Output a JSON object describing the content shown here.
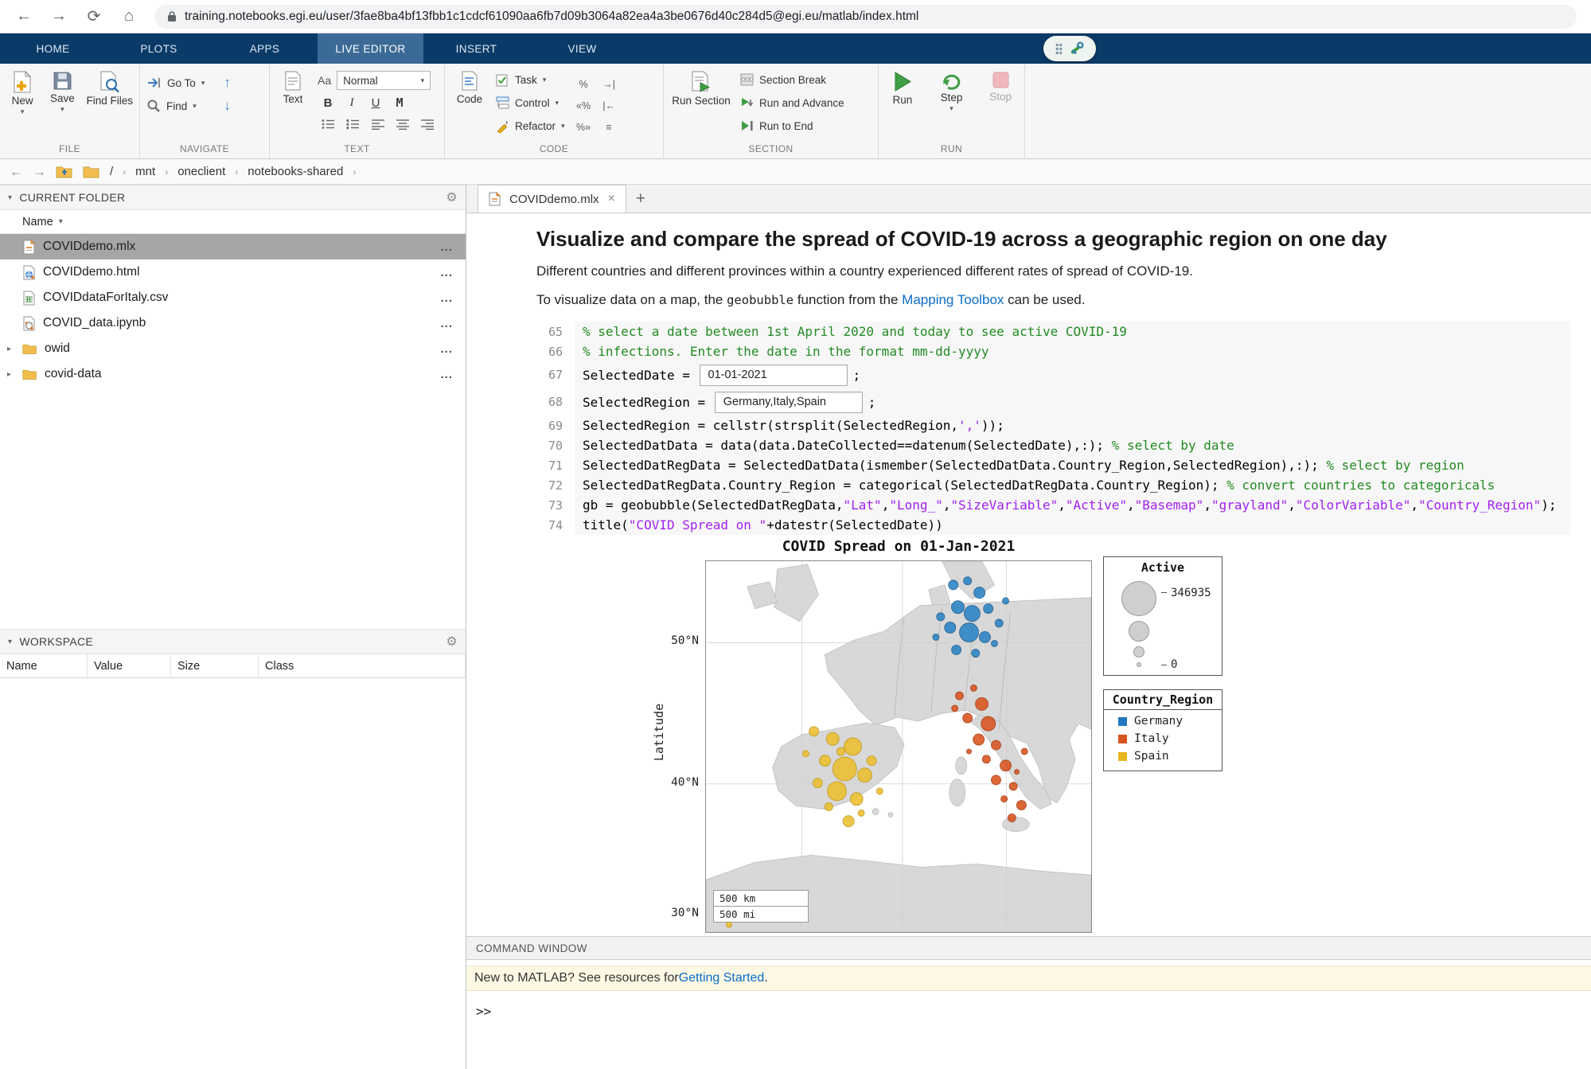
{
  "browser": {
    "url": "training.notebooks.egi.eu/user/3fae8ba4bf13fbb1c1cdcf61090aa6fb7d09b3064a82ea4a3be0676d40c284d5@egi.eu/matlab/index.html"
  },
  "ribbon": {
    "tabs": [
      {
        "label": "HOME"
      },
      {
        "label": "PLOTS"
      },
      {
        "label": "APPS"
      },
      {
        "label": "LIVE EDITOR",
        "active": true
      },
      {
        "label": "INSERT"
      },
      {
        "label": "VIEW"
      }
    ]
  },
  "toolstrip": {
    "file": {
      "label": "FILE",
      "new": "New",
      "save": "Save",
      "find_files": "Find Files"
    },
    "navigate": {
      "label": "NAVIGATE",
      "goto": "Go To",
      "find": "Find"
    },
    "text": {
      "label": "TEXT",
      "text": "Text",
      "style_icon": "Aa",
      "style": "Normal",
      "bold": "B",
      "italic": "I",
      "underline": "U",
      "mono": "M"
    },
    "code": {
      "label": "CODE",
      "code": "Code",
      "task": "Task",
      "control": "Control",
      "refactor": "Refactor",
      "comment": "%",
      "comment_wrap": "%»",
      "uncomment": "«%",
      "indent": "→|",
      "outdent": "|←",
      "smart_indent": "≡"
    },
    "section": {
      "label": "SECTION",
      "run_section": "Run Section",
      "section_break": "Section Break",
      "run_and_advance": "Run and Advance",
      "run_to_end": "Run to End"
    },
    "run": {
      "label": "RUN",
      "run": "Run",
      "step": "Step",
      "stop": "Stop"
    }
  },
  "breadcrumb": {
    "root": "/",
    "segments": [
      "mnt",
      "oneclient",
      "notebooks-shared"
    ]
  },
  "current_folder": {
    "title": "CURRENT FOLDER",
    "name_header": "Name",
    "ellipsis": "...",
    "files": [
      {
        "name": "COVIDdemo.mlx",
        "type": "mlx",
        "selected": true
      },
      {
        "name": "COVIDdemo.html",
        "type": "html"
      },
      {
        "name": "COVIDdataForItaly.csv",
        "type": "csv"
      },
      {
        "name": "COVID_data.ipynb",
        "type": "ipynb"
      },
      {
        "name": "owid",
        "type": "folder"
      },
      {
        "name": "covid-data",
        "type": "folder"
      }
    ]
  },
  "workspace": {
    "title": "WORKSPACE",
    "columns": [
      "Name",
      "Value",
      "Size",
      "Class"
    ]
  },
  "editor": {
    "tab": "COVIDdemo.mlx",
    "close": "×",
    "plus": "+",
    "title": "Visualize and compare the spread of COVID-19 across a geographic region on one day",
    "para1": "Different countries and different provinces within a country experienced different rates of spread of COVID-19.",
    "para2_runs": [
      {
        "k": "text",
        "t": "To visualize data on a map, the "
      },
      {
        "k": "code",
        "t": "geobubble"
      },
      {
        "k": "text",
        "t": " function from the "
      },
      {
        "k": "link",
        "t": "Mapping Toolbox"
      },
      {
        "k": "text",
        "t": " can be used."
      }
    ],
    "code": [
      {
        "num": "65",
        "segments": [
          {
            "k": "comment",
            "t": "% select a date between 1st April 2020 and today to see active COVID-19"
          }
        ]
      },
      {
        "num": "66",
        "segments": [
          {
            "k": "comment",
            "t": "% infections. Enter the date in the format mm-dd-yyyy"
          }
        ]
      },
      {
        "num": "67",
        "segments": [
          {
            "k": "code",
            "t": "SelectedDate = "
          },
          {
            "k": "input",
            "t": "01-01-2021"
          },
          {
            "k": "code",
            "t": ";"
          }
        ]
      },
      {
        "num": "68",
        "segments": [
          {
            "k": "code",
            "t": "SelectedRegion = "
          },
          {
            "k": "input",
            "t": "Germany,Italy,Spain"
          },
          {
            "k": "code",
            "t": ";"
          }
        ]
      },
      {
        "num": "69",
        "segments": [
          {
            "k": "code",
            "t": "SelectedRegion = cellstr(strsplit(SelectedRegion,"
          },
          {
            "k": "string",
            "t": "','"
          },
          {
            "k": "code",
            "t": "));"
          }
        ]
      },
      {
        "num": "70",
        "segments": [
          {
            "k": "code",
            "t": "SelectedDatData = data(data.DateCollected==datenum(SelectedDate),:); "
          },
          {
            "k": "comment",
            "t": "% select by date"
          }
        ]
      },
      {
        "num": "71",
        "segments": [
          {
            "k": "code",
            "t": "SelectedDatRegData = SelectedDatData(ismember(SelectedDatData.Country_Region,SelectedRegion),:); "
          },
          {
            "k": "comment",
            "t": "% select by region"
          }
        ]
      },
      {
        "num": "72",
        "segments": [
          {
            "k": "code",
            "t": "SelectedDatRegData.Country_Region = categorical(SelectedDatRegData.Country_Region); "
          },
          {
            "k": "comment",
            "t": "% convert countries to categoricals"
          }
        ]
      },
      {
        "num": "73",
        "segments": [
          {
            "k": "code",
            "t": "gb = geobubble(SelectedDatRegData,"
          },
          {
            "k": "string",
            "t": "\"Lat\""
          },
          {
            "k": "code",
            "t": ","
          },
          {
            "k": "string",
            "t": "\"Long_\""
          },
          {
            "k": "code",
            "t": ","
          },
          {
            "k": "string",
            "t": "\"SizeVariable\""
          },
          {
            "k": "code",
            "t": ","
          },
          {
            "k": "string",
            "t": "\"Active\""
          },
          {
            "k": "code",
            "t": ","
          },
          {
            "k": "string",
            "t": "\"Basemap\""
          },
          {
            "k": "code",
            "t": ","
          },
          {
            "k": "string",
            "t": "\"grayland\""
          },
          {
            "k": "code",
            "t": ","
          },
          {
            "k": "string",
            "t": "\"ColorVariable\""
          },
          {
            "k": "code",
            "t": ","
          },
          {
            "k": "string",
            "t": "\"Country_Region\""
          },
          {
            "k": "code",
            "t": ");"
          }
        ]
      },
      {
        "num": "74",
        "segments": [
          {
            "k": "code",
            "t": "title("
          },
          {
            "k": "string",
            "t": "\"COVID Spread on \""
          },
          {
            "k": "code",
            "t": "+datestr(SelectedDate))"
          }
        ]
      }
    ]
  },
  "chart_data": {
    "type": "scatter",
    "subtype": "geobubble",
    "title": "COVID Spread on 01-Jan-2021",
    "ylabel": "Latitude",
    "yticks": [
      {
        "label": "50°N",
        "y_pct": 22
      },
      {
        "label": "40°N",
        "y_pct": 60
      },
      {
        "label": "30°N",
        "y_pct": 95
      }
    ],
    "scale": {
      "km": "500 km",
      "mi": "500 mi"
    },
    "size_legend": {
      "title": "Active",
      "max": "346935",
      "min": "0"
    },
    "color_legend": {
      "title": "Country_Region",
      "entries": [
        {
          "label": "Germany",
          "color": "#1f78bf"
        },
        {
          "label": "Italy",
          "color": "#d9541e"
        },
        {
          "label": "Spain",
          "color": "#e8b51f"
        }
      ]
    },
    "series": [
      {
        "name": "Germany",
        "color": "#2b83c4",
        "edge": "#1b5e93",
        "bubbles": [
          [
            64.2,
            6.4,
            6
          ],
          [
            67.9,
            5.3,
            5
          ],
          [
            71.0,
            8.5,
            7
          ],
          [
            65.4,
            12.4,
            8
          ],
          [
            69.1,
            14.1,
            10
          ],
          [
            73.3,
            12.8,
            6
          ],
          [
            63.4,
            17.9,
            7
          ],
          [
            68.3,
            19.2,
            12
          ],
          [
            72.4,
            20.5,
            7
          ],
          [
            76.1,
            16.7,
            5
          ],
          [
            65.0,
            23.9,
            6
          ],
          [
            70.0,
            24.8,
            5
          ],
          [
            60.9,
            15.0,
            5
          ],
          [
            74.9,
            22.2,
            4
          ],
          [
            77.8,
            10.7,
            4
          ],
          [
            59.7,
            20.5,
            4
          ]
        ]
      },
      {
        "name": "Italy",
        "color": "#d9531e",
        "edge": "#a83c12",
        "bubbles": [
          [
            65.8,
            36.3,
            5
          ],
          [
            69.5,
            34.2,
            4
          ],
          [
            71.6,
            38.5,
            8
          ],
          [
            67.9,
            42.3,
            6
          ],
          [
            73.3,
            43.8,
            9
          ],
          [
            70.8,
            48.1,
            7
          ],
          [
            75.3,
            49.6,
            6
          ],
          [
            72.8,
            53.4,
            5
          ],
          [
            77.8,
            55.1,
            7
          ],
          [
            75.3,
            59.0,
            6
          ],
          [
            79.8,
            60.7,
            5
          ],
          [
            77.4,
            64.1,
            4
          ],
          [
            81.9,
            65.8,
            6
          ],
          [
            79.4,
            69.2,
            5
          ],
          [
            82.7,
            51.3,
            4
          ],
          [
            64.6,
            39.7,
            4
          ],
          [
            68.3,
            51.3,
            3
          ],
          [
            80.7,
            56.8,
            3
          ]
        ]
      },
      {
        "name": "Spain",
        "color": "#ecc02f",
        "edge": "#c49a1a",
        "bubbles": [
          [
            28.0,
            45.9,
            6
          ],
          [
            32.9,
            47.9,
            8
          ],
          [
            38.1,
            50.0,
            11
          ],
          [
            30.9,
            53.8,
            7
          ],
          [
            36.0,
            56.0,
            15
          ],
          [
            41.2,
            57.7,
            9
          ],
          [
            34.0,
            62.0,
            12
          ],
          [
            39.1,
            64.1,
            8
          ],
          [
            29.0,
            59.8,
            6
          ],
          [
            43.0,
            53.8,
            6
          ],
          [
            37.0,
            70.1,
            7
          ],
          [
            31.9,
            66.2,
            5
          ],
          [
            45.1,
            62.0,
            4
          ],
          [
            25.9,
            51.9,
            4
          ],
          [
            35.0,
            51.3,
            5
          ],
          [
            40.3,
            67.9,
            4
          ],
          [
            6.0,
            98.0,
            3.5
          ]
        ]
      }
    ]
  },
  "command_window": {
    "title": "COMMAND WINDOW",
    "info_runs": [
      {
        "k": "text",
        "t": "New to MATLAB? See resources for "
      },
      {
        "k": "link",
        "t": "Getting Started"
      },
      {
        "k": "text",
        "t": "."
      }
    ],
    "prompt": ">>"
  }
}
